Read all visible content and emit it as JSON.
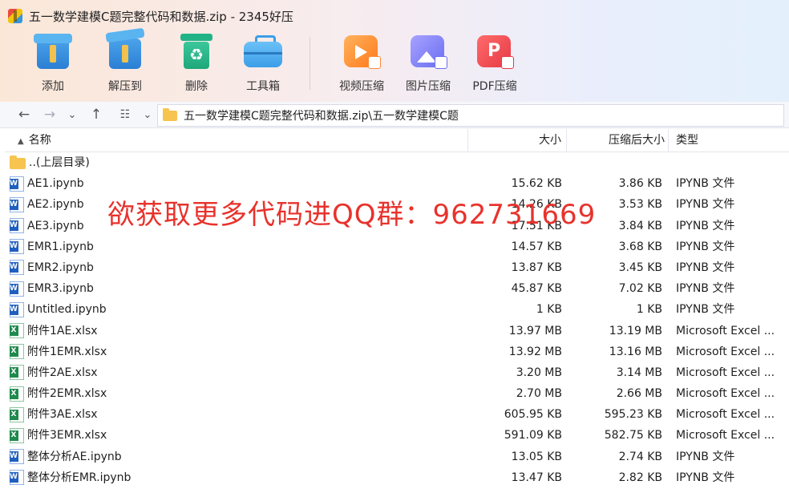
{
  "window": {
    "title": "五一数学建模C题完整代码和数据.zip - 2345好压"
  },
  "toolbar": {
    "add": "添加",
    "extract": "解压到",
    "delete": "删除",
    "tools": "工具箱",
    "video": "视频压缩",
    "image": "图片压缩",
    "pdf": "PDF压缩"
  },
  "nav": {
    "path": "五一数学建模C题完整代码和数据.zip\\五一数学建模C题"
  },
  "columns": {
    "name": "名称",
    "size": "大小",
    "packed": "压缩后大小",
    "type": "类型"
  },
  "files": [
    {
      "icon": "folder-icon",
      "name": "..(上层目录)",
      "size": "",
      "packed": "",
      "type": ""
    },
    {
      "icon": "word-icon",
      "name": "AE1.ipynb",
      "size": "15.62 KB",
      "packed": "3.86 KB",
      "type": "IPYNB 文件"
    },
    {
      "icon": "word-icon",
      "name": "AE2.ipynb",
      "size": "14.26 KB",
      "packed": "3.53 KB",
      "type": "IPYNB 文件"
    },
    {
      "icon": "word-icon",
      "name": "AE3.ipynb",
      "size": "17.51 KB",
      "packed": "3.84 KB",
      "type": "IPYNB 文件"
    },
    {
      "icon": "word-icon",
      "name": "EMR1.ipynb",
      "size": "14.57 KB",
      "packed": "3.68 KB",
      "type": "IPYNB 文件"
    },
    {
      "icon": "word-icon",
      "name": "EMR2.ipynb",
      "size": "13.87 KB",
      "packed": "3.45 KB",
      "type": "IPYNB 文件"
    },
    {
      "icon": "word-icon",
      "name": "EMR3.ipynb",
      "size": "45.87 KB",
      "packed": "7.02 KB",
      "type": "IPYNB 文件"
    },
    {
      "icon": "word-icon",
      "name": "Untitled.ipynb",
      "size": "1 KB",
      "packed": "1 KB",
      "type": "IPYNB 文件"
    },
    {
      "icon": "excel-icon",
      "name": "附件1AE.xlsx",
      "size": "13.97 MB",
      "packed": "13.19 MB",
      "type": "Microsoft Excel ..."
    },
    {
      "icon": "excel-icon",
      "name": "附件1EMR.xlsx",
      "size": "13.92 MB",
      "packed": "13.16 MB",
      "type": "Microsoft Excel ..."
    },
    {
      "icon": "excel-icon",
      "name": "附件2AE.xlsx",
      "size": "3.20 MB",
      "packed": "3.14 MB",
      "type": "Microsoft Excel ..."
    },
    {
      "icon": "excel-icon",
      "name": "附件2EMR.xlsx",
      "size": "2.70 MB",
      "packed": "2.66 MB",
      "type": "Microsoft Excel ..."
    },
    {
      "icon": "excel-icon",
      "name": "附件3AE.xlsx",
      "size": "605.95 KB",
      "packed": "595.23 KB",
      "type": "Microsoft Excel ..."
    },
    {
      "icon": "excel-icon",
      "name": "附件3EMR.xlsx",
      "size": "591.09 KB",
      "packed": "582.75 KB",
      "type": "Microsoft Excel ..."
    },
    {
      "icon": "word-icon",
      "name": "整体分析AE.ipynb",
      "size": "13.05 KB",
      "packed": "2.74 KB",
      "type": "IPYNB 文件"
    },
    {
      "icon": "word-icon",
      "name": "整体分析EMR.ipynb",
      "size": "13.47 KB",
      "packed": "2.82 KB",
      "type": "IPYNB 文件"
    }
  ],
  "overlay": {
    "text": "欲获取更多代码进QQ群：962731669",
    "color": "#e8322c"
  }
}
